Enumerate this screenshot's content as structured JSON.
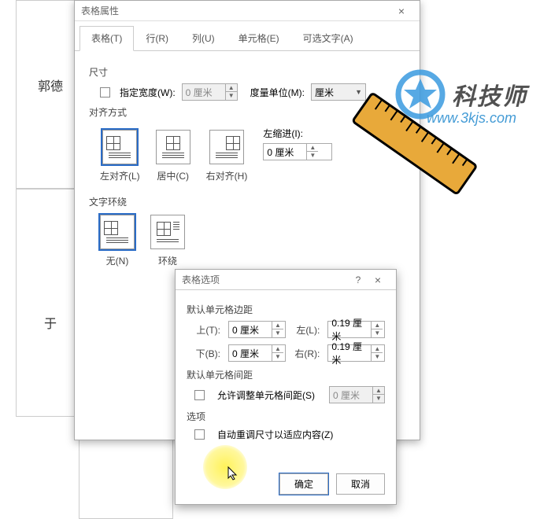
{
  "bg_text": {
    "name1": "郭德",
    "name2": "于"
  },
  "dialog1": {
    "title": "表格属性",
    "tabs": [
      "表格(T)",
      "行(R)",
      "列(U)",
      "单元格(E)",
      "可选文字(A)"
    ],
    "size_label": "尺寸",
    "spec_width": "指定宽度(W):",
    "width_val": "0 厘米",
    "unit_label": "度量单位(M):",
    "unit_val": "厘米",
    "align_label": "对齐方式",
    "align_left": "左对齐(L)",
    "align_center": "居中(C)",
    "align_right": "右对齐(H)",
    "indent_label": "左缩进(I):",
    "indent_val": "0 厘米",
    "wrap_label": "文字环绕",
    "wrap_none": "无(N)",
    "wrap_around": "环绕"
  },
  "dialog2": {
    "title": "表格选项",
    "margins_label": "默认单元格边距",
    "top": "上(T):",
    "bottom": "下(B):",
    "left": "左(L):",
    "right": "右(R):",
    "val_zero": "0 厘米",
    "val_019": "0.19 厘米",
    "spacing_label": "默认单元格间距",
    "allow_spacing": "允许调整单元格间距(S)",
    "spacing_val": "0 厘米",
    "options_label": "选项",
    "auto_resize": "自动重调尺寸以适应内容(Z)",
    "ok": "确定",
    "cancel": "取消"
  },
  "watermark": {
    "brand": "科技师",
    "url": "www.3kjs.com"
  }
}
